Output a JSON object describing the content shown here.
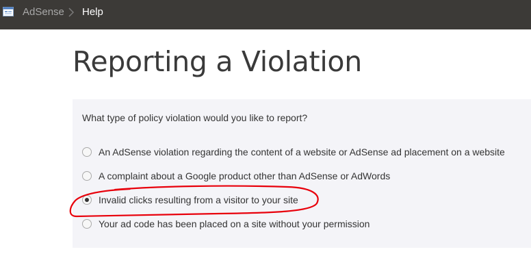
{
  "topbar": {
    "app_icon": "adsense-window-icon",
    "breadcrumb": {
      "root": "AdSense",
      "separator_icon": "chevron-right-icon",
      "current": "Help"
    },
    "background": "#3c3a37"
  },
  "page": {
    "title": "Reporting a Violation"
  },
  "form": {
    "question": "What type of policy violation would you like to report?",
    "options": [
      {
        "label": "An AdSense violation regarding the content of a website or AdSense ad placement on a website",
        "selected": false
      },
      {
        "label": "A complaint about a Google product other than AdSense or AdWords",
        "selected": false
      },
      {
        "label": "Invalid clicks resulting from a visitor to your site",
        "selected": true
      },
      {
        "label": "Your ad code has been placed on a site without your permission",
        "selected": false
      }
    ],
    "panel_background": "#f4f4f8"
  },
  "annotation": {
    "type": "hand-drawn-circle",
    "color": "#e8000b",
    "target_option": 2
  }
}
